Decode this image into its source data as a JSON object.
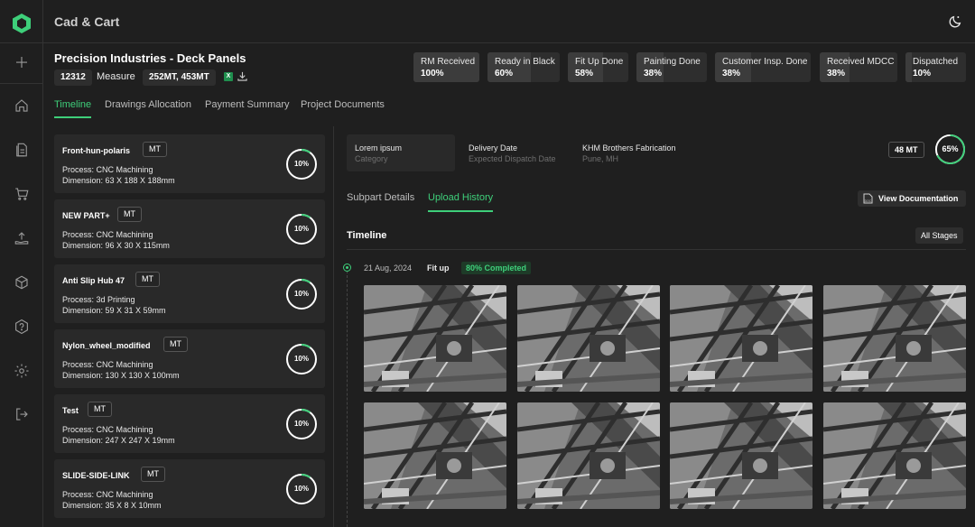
{
  "app": {
    "title": "Cad & Cart"
  },
  "sidebar": {
    "items": [
      {
        "name": "add-icon"
      },
      {
        "name": "home-icon"
      },
      {
        "name": "documents-icon"
      },
      {
        "name": "cart-icon"
      },
      {
        "name": "upload-icon"
      },
      {
        "name": "box-icon"
      },
      {
        "name": "help-icon"
      },
      {
        "name": "settings-icon"
      },
      {
        "name": "logout-icon"
      }
    ]
  },
  "project": {
    "title": "Precision Industries - Deck Panels",
    "id": "12312",
    "measure_label": "Measure",
    "measure_value": "252MT, 453MT",
    "excel_icon_text": "X"
  },
  "stages": [
    {
      "label": "RM Received",
      "value": "100%",
      "fraction": 1.0
    },
    {
      "label": "Ready in Black",
      "value": "60%",
      "fraction": 0.6
    },
    {
      "label": "Fit Up Done",
      "value": "58%",
      "fraction": 0.58
    },
    {
      "label": "Painting Done",
      "value": "38%",
      "fraction": 0.38
    },
    {
      "label": "Customer Insp. Done",
      "value": "38%",
      "fraction": 0.38
    },
    {
      "label": "Received MDCC",
      "value": "38%",
      "fraction": 0.38
    },
    {
      "label": "Dispatched",
      "value": "10%",
      "fraction": 0.1
    }
  ],
  "tabs": [
    {
      "label": "Timeline"
    },
    {
      "label": "Drawings Allocation"
    },
    {
      "label": "Payment Summary"
    },
    {
      "label": "Project Documents"
    }
  ],
  "parts": [
    {
      "name": "Front-hun-polaris",
      "unit": "MT",
      "process": "Process: CNC Machining",
      "dimension": "Dimension: 63 X 188 X 188mm",
      "progress": "10%"
    },
    {
      "name": "NEW PART+",
      "unit": "MT",
      "process": "Process: CNC Machining",
      "dimension": "Dimension: 96 X 30 X 115mm",
      "progress": "10%"
    },
    {
      "name": "Anti Slip Hub 47",
      "unit": "MT",
      "process": "Process: 3d Printing",
      "dimension": "Dimension: 59 X 31 X 59mm",
      "progress": "10%"
    },
    {
      "name": "Nylon_wheel_modified",
      "unit": "MT",
      "process": "Process: CNC Machining",
      "dimension": "Dimension: 130 X 130 X 100mm",
      "progress": "10%"
    },
    {
      "name": "Test",
      "unit": "MT",
      "process": "Process: CNC Machining",
      "dimension": "Dimension: 247 X 247 X 19mm",
      "progress": "10%"
    },
    {
      "name": "SLIDE-SIDE-LINK",
      "unit": "MT",
      "process": "Process: CNC Machining",
      "dimension": "Dimension: 35 X 8 X 10mm",
      "progress": "10%"
    }
  ],
  "detail": {
    "category_title": "Lorem ipsum",
    "category_sub": "Category",
    "delivery_title": "Delivery Date",
    "delivery_sub": "Expected Dispatch Date",
    "vendor_title": "KHM Brothers Fabrication",
    "vendor_sub": "Pune, MH",
    "weight": "48 MT",
    "progress": "65%",
    "subtabs": [
      {
        "label": "Subpart Details"
      },
      {
        "label": "Upload History"
      }
    ],
    "view_doc_label": "View Documentation",
    "doc_icon_text": "DOC"
  },
  "timeline": {
    "title": "Timeline",
    "filter_label": "All Stages",
    "entries": [
      {
        "date": "21 Aug, 2024",
        "stage": "Fit up",
        "status": "80% Completed",
        "photo_count": 8
      }
    ]
  },
  "colors": {
    "accent": "#3ecf7a",
    "bg": "#1f1f1f",
    "card": "#292929"
  }
}
